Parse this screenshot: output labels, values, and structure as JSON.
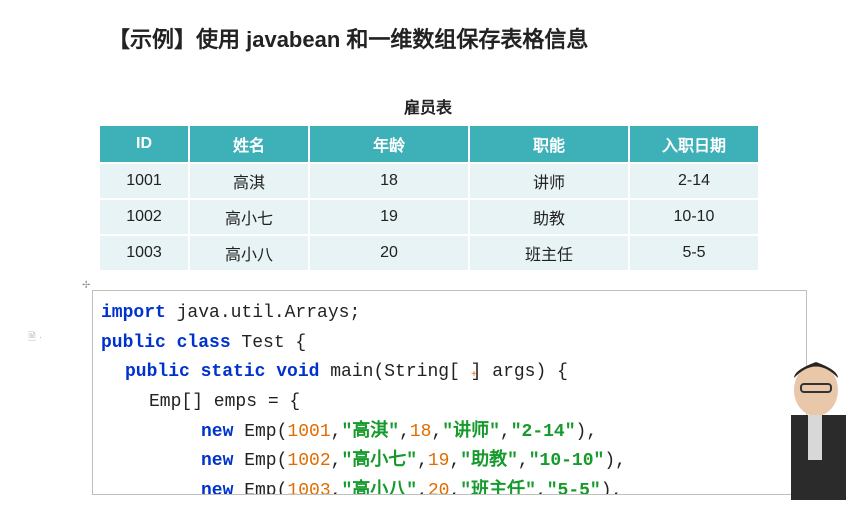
{
  "title": "【示例】使用 javabean 和一维数组保存表格信息",
  "table": {
    "caption": "雇员表",
    "headers": [
      "ID",
      "姓名",
      "年龄",
      "职能",
      "入职日期"
    ],
    "rows": [
      [
        "1001",
        "高淇",
        "18",
        "讲师",
        "2-14"
      ],
      [
        "1002",
        "高小七",
        "19",
        "助教",
        "10-10"
      ],
      [
        "1003",
        "高小八",
        "20",
        "班主任",
        "5-5"
      ]
    ]
  },
  "code": {
    "l1a": "import",
    "l1b": " java.util.Arrays;",
    "l2a": "public class",
    "l2b": " Test {",
    "l3a": "public static void",
    "l3b": " main(String[ ] args) {",
    "l4": "Emp[] emps = {",
    "new": "new",
    "e1_id": "1001",
    "e1_name": "\"高淇\"",
    "e1_age": "18",
    "e1_role": "\"讲师\"",
    "e1_date": "\"2-14\"",
    "e2_id": "1002",
    "e2_name": "\"高小七\"",
    "e2_age": "19",
    "e2_role": "\"助教\"",
    "e2_date": "\"10-10\"",
    "e3_id": "1003",
    "e3_name": "\"高小八\"",
    "e3_age": "20",
    "e3_role": "\"班主任\"",
    "e3_date": "\"5-5\""
  }
}
